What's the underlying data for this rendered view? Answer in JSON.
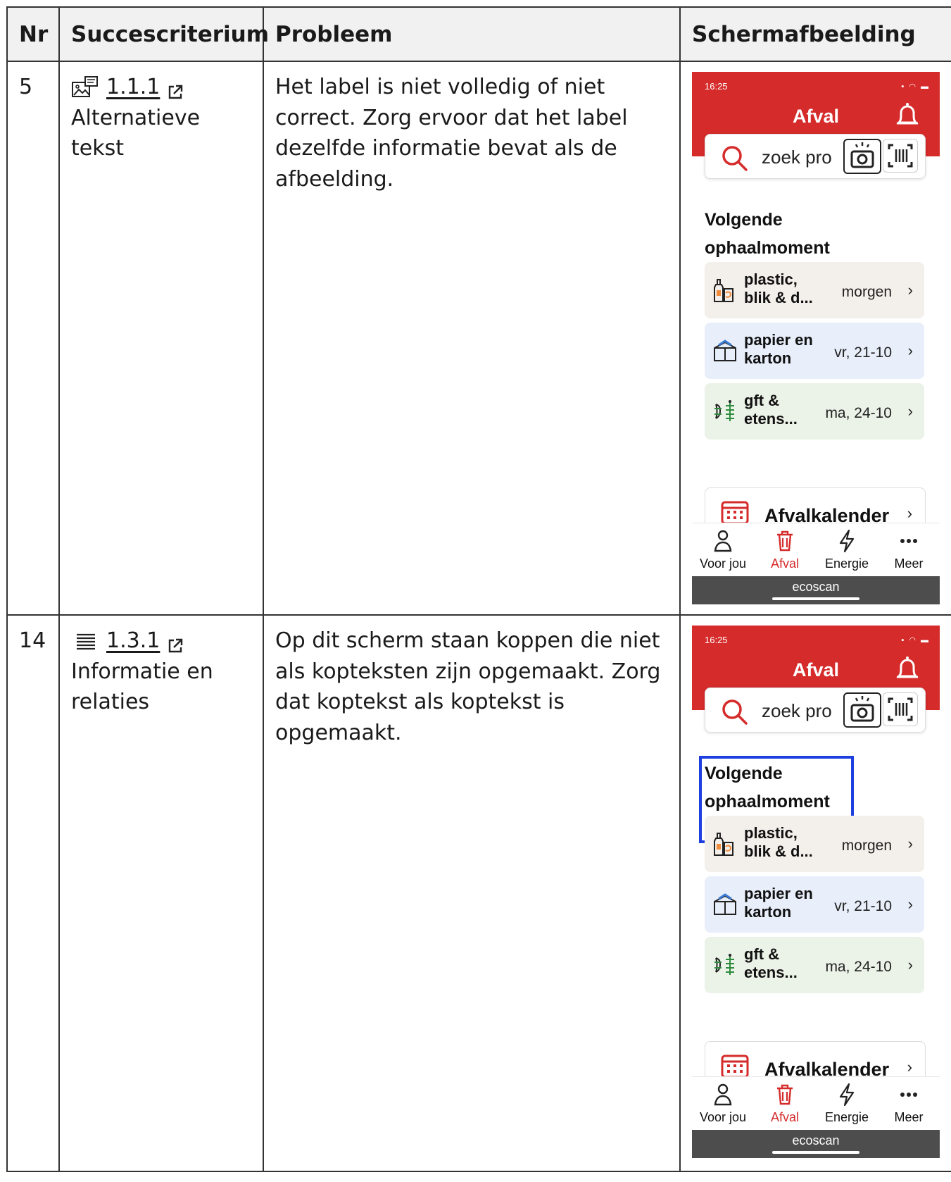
{
  "table": {
    "headers": {
      "nr": "Nr",
      "criterion": "Succescriterium",
      "problem": "Probleem",
      "screenshot": "Schermafbeelding"
    },
    "rows": [
      {
        "nr": "5",
        "criterion_code": "1.1.1",
        "criterion_name": "Alternatieve tekst",
        "criterion_icon": "image-text-icon",
        "problem": "Het label is niet volledig of niet correct. Zorg ervoor dat het label dezelfde informatie bevat als de afbeelding.",
        "highlight_heading": false
      },
      {
        "nr": "14",
        "criterion_code": "1.3.1",
        "criterion_name": "Informatie en relaties",
        "criterion_icon": "list-lines-icon",
        "problem": "Op dit scherm staan koppen die niet als kopteksten zijn opgemaakt. Zorg dat koptekst als koptekst is opgemaakt.",
        "highlight_heading": true
      }
    ]
  },
  "phone": {
    "time": "16:25",
    "title": "Afval",
    "search_placeholder": "zoek pro",
    "heading": "Volgende ophaalmoment",
    "cards": [
      {
        "name": "plastic, blik & d...",
        "date": "morgen",
        "bg": "#f3efea",
        "icon": "plastic-bottle-icon"
      },
      {
        "name": "papier en karton",
        "date": "vr, 21-10",
        "bg": "#e8eefa",
        "icon": "paper-box-icon"
      },
      {
        "name": "gft & etens...",
        "date": "ma, 24-10",
        "bg": "#ebf3e8",
        "icon": "organic-waste-icon"
      }
    ],
    "calendar_label": "Afvalkalender",
    "tabs": [
      {
        "label": "Voor jou",
        "icon": "person-icon",
        "active": false
      },
      {
        "label": "Afval",
        "icon": "trash-icon",
        "active": true
      },
      {
        "label": "Energie",
        "icon": "lightning-icon",
        "active": false
      },
      {
        "label": "Meer",
        "icon": "more-icon",
        "active": false
      }
    ],
    "brand": "ecoscan",
    "colors": {
      "brand_red": "#d62b2b",
      "focus_blue": "#1d3fe0",
      "bar_gray": "#4d4d4d"
    }
  }
}
